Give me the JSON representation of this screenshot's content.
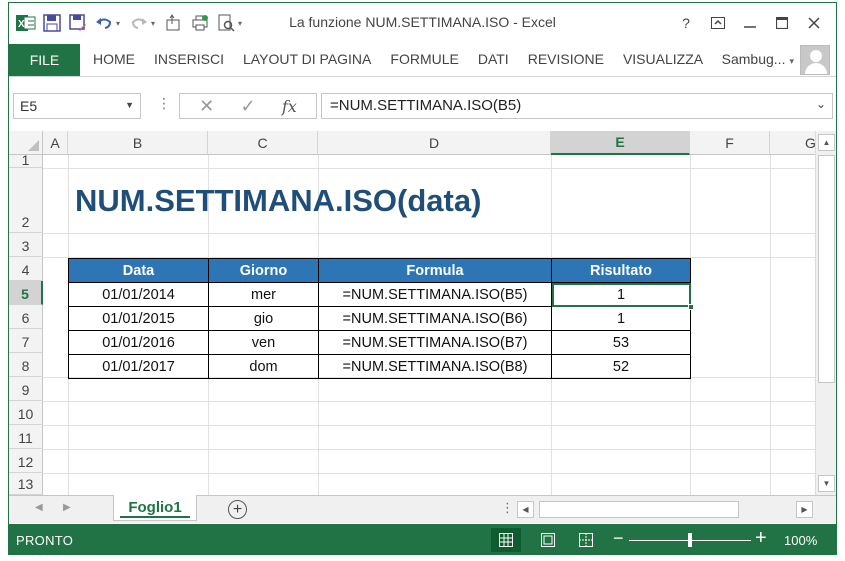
{
  "window": {
    "title": "La funzione NUM.SETTIMANA.ISO - Excel"
  },
  "title_controls": {
    "help": "?",
    "restore": "⧉",
    "minimize": "—",
    "maximize": "☐",
    "close": "✕"
  },
  "ribbon": {
    "file_label": "FILE",
    "tabs": [
      "HOME",
      "INSERISCI",
      "LAYOUT DI PAGINA",
      "FORMULE",
      "DATI",
      "REVISIONE",
      "VISUALIZZA"
    ],
    "user_name": "Sambug..."
  },
  "formula_bar": {
    "name_box": "E5",
    "cancel_glyph": "✕",
    "enter_glyph": "✓",
    "fx_label": "fx",
    "formula": "=NUM.SETTIMANA.ISO(B5)"
  },
  "columns": [
    "A",
    "B",
    "C",
    "D",
    "E",
    "F",
    "G"
  ],
  "rows": [
    "1",
    "2",
    "3",
    "4",
    "5",
    "6",
    "7",
    "8",
    "9",
    "10",
    "11",
    "12",
    "13"
  ],
  "selected": {
    "column": "E",
    "row": "5"
  },
  "sheet": {
    "heading": "NUM.SETTIMANA.ISO(data)",
    "table": {
      "headers": [
        "Data",
        "Giorno",
        "Formula",
        "Risultato"
      ],
      "rows": [
        [
          "01/01/2014",
          "mer",
          "=NUM.SETTIMANA.ISO(B5)",
          "1"
        ],
        [
          "01/01/2015",
          "gio",
          "=NUM.SETTIMANA.ISO(B6)",
          "1"
        ],
        [
          "01/01/2016",
          "ven",
          "=NUM.SETTIMANA.ISO(B7)",
          "53"
        ],
        [
          "01/01/2017",
          "dom",
          "=NUM.SETTIMANA.ISO(B8)",
          "52"
        ]
      ]
    }
  },
  "sheet_tabs": {
    "active": "Foglio1",
    "add_glyph": "+"
  },
  "status_bar": {
    "ready": "PRONTO",
    "zoom_minus": "−",
    "zoom_plus": "+",
    "zoom_percent": "100%",
    "zoom_level": 1.0
  },
  "colors": {
    "excel_green": "#217346",
    "heading_blue": "#1f4e79",
    "table_header_fill": "#2e75b6"
  }
}
